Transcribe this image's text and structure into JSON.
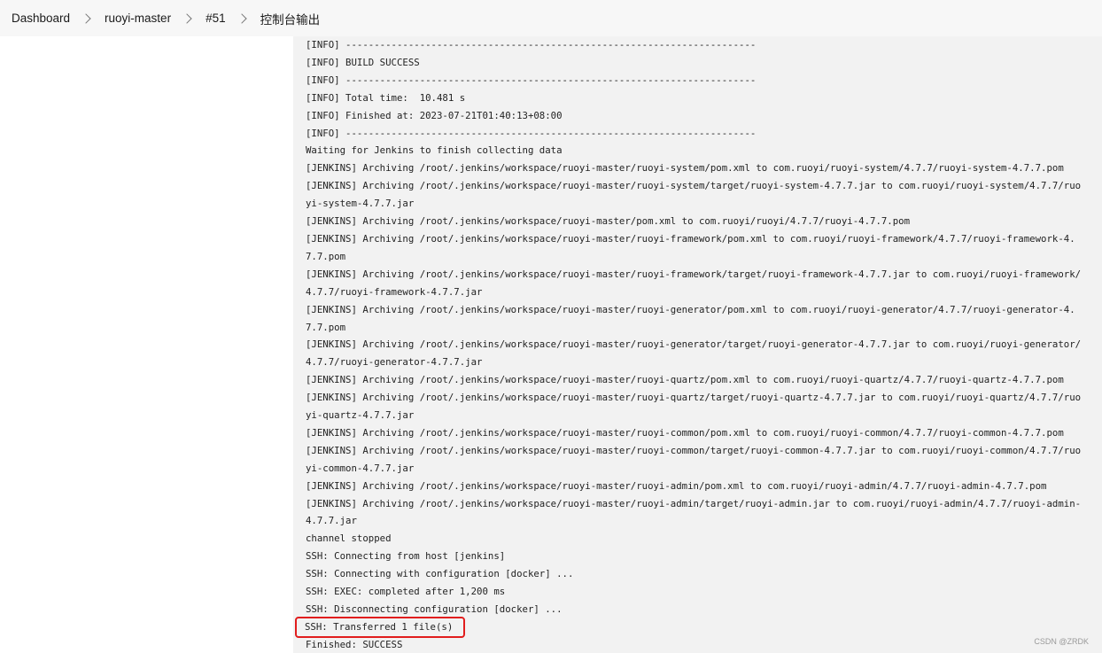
{
  "breadcrumb": {
    "items": [
      "Dashboard",
      "ruoyi-master",
      "#51",
      "控制台输出"
    ]
  },
  "console": {
    "lines": [
      "[INFO] ------------------------------------------------------------------------",
      "[INFO] BUILD SUCCESS",
      "[INFO] ------------------------------------------------------------------------",
      "[INFO] Total time:  10.481 s",
      "[INFO] Finished at: 2023-07-21T01:40:13+08:00",
      "[INFO] ------------------------------------------------------------------------",
      "Waiting for Jenkins to finish collecting data",
      "[JENKINS] Archiving /root/.jenkins/workspace/ruoyi-master/ruoyi-system/pom.xml to com.ruoyi/ruoyi-system/4.7.7/ruoyi-system-4.7.7.pom",
      "[JENKINS] Archiving /root/.jenkins/workspace/ruoyi-master/ruoyi-system/target/ruoyi-system-4.7.7.jar to com.ruoyi/ruoyi-system/4.7.7/ruoyi-system-4.7.7.jar",
      "[JENKINS] Archiving /root/.jenkins/workspace/ruoyi-master/pom.xml to com.ruoyi/ruoyi/4.7.7/ruoyi-4.7.7.pom",
      "[JENKINS] Archiving /root/.jenkins/workspace/ruoyi-master/ruoyi-framework/pom.xml to com.ruoyi/ruoyi-framework/4.7.7/ruoyi-framework-4.7.7.pom",
      "[JENKINS] Archiving /root/.jenkins/workspace/ruoyi-master/ruoyi-framework/target/ruoyi-framework-4.7.7.jar to com.ruoyi/ruoyi-framework/4.7.7/ruoyi-framework-4.7.7.jar",
      "[JENKINS] Archiving /root/.jenkins/workspace/ruoyi-master/ruoyi-generator/pom.xml to com.ruoyi/ruoyi-generator/4.7.7/ruoyi-generator-4.7.7.pom",
      "[JENKINS] Archiving /root/.jenkins/workspace/ruoyi-master/ruoyi-generator/target/ruoyi-generator-4.7.7.jar to com.ruoyi/ruoyi-generator/4.7.7/ruoyi-generator-4.7.7.jar",
      "[JENKINS] Archiving /root/.jenkins/workspace/ruoyi-master/ruoyi-quartz/pom.xml to com.ruoyi/ruoyi-quartz/4.7.7/ruoyi-quartz-4.7.7.pom",
      "[JENKINS] Archiving /root/.jenkins/workspace/ruoyi-master/ruoyi-quartz/target/ruoyi-quartz-4.7.7.jar to com.ruoyi/ruoyi-quartz/4.7.7/ruoyi-quartz-4.7.7.jar",
      "[JENKINS] Archiving /root/.jenkins/workspace/ruoyi-master/ruoyi-common/pom.xml to com.ruoyi/ruoyi-common/4.7.7/ruoyi-common-4.7.7.pom",
      "[JENKINS] Archiving /root/.jenkins/workspace/ruoyi-master/ruoyi-common/target/ruoyi-common-4.7.7.jar to com.ruoyi/ruoyi-common/4.7.7/ruoyi-common-4.7.7.jar",
      "[JENKINS] Archiving /root/.jenkins/workspace/ruoyi-master/ruoyi-admin/pom.xml to com.ruoyi/ruoyi-admin/4.7.7/ruoyi-admin-4.7.7.pom",
      "[JENKINS] Archiving /root/.jenkins/workspace/ruoyi-master/ruoyi-admin/target/ruoyi-admin.jar to com.ruoyi/ruoyi-admin/4.7.7/ruoyi-admin-4.7.7.jar",
      "channel stopped",
      "SSH: Connecting from host [jenkins]",
      "SSH: Connecting with configuration [docker] ...",
      "SSH: EXEC: completed after 1,200 ms",
      "SSH: Disconnecting configuration [docker] ..."
    ],
    "highlighted_line": "SSH: Transferred 1 file(s)",
    "final_line": "Finished: SUCCESS"
  },
  "watermark": "CSDN @ZRDK",
  "colors": {
    "highlight_border": "#e11d1d",
    "console_bg": "#f2f2f2",
    "breadcrumb_bg": "#f7f7f7"
  }
}
